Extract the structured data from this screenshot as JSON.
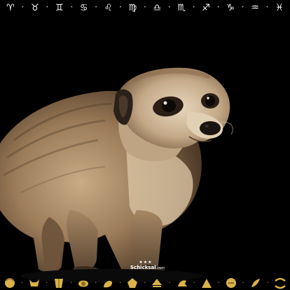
{
  "zodiac": {
    "signs": [
      {
        "name": "aries",
        "glyph": "♈"
      },
      {
        "name": "taurus",
        "glyph": "♉"
      },
      {
        "name": "gemini",
        "glyph": "♊"
      },
      {
        "name": "cancer",
        "glyph": "♋"
      },
      {
        "name": "leo",
        "glyph": "♌"
      },
      {
        "name": "virgo",
        "glyph": "♍"
      },
      {
        "name": "libra",
        "glyph": "♎"
      },
      {
        "name": "scorpio",
        "glyph": "♏"
      },
      {
        "name": "sagittarius",
        "glyph": "♐"
      },
      {
        "name": "capricorn",
        "glyph": "♑"
      },
      {
        "name": "aquarius",
        "glyph": "♒"
      },
      {
        "name": "pisces",
        "glyph": "♓"
      }
    ],
    "separator": "•"
  },
  "logo": {
    "stars": "★★★",
    "name": "Schicksal",
    "suffix": ".com"
  },
  "gold_bar": {
    "separator": "•",
    "icons": [
      "ram-icon",
      "bull-icon",
      "twins-icon",
      "crab-icon",
      "lion-icon",
      "maiden-icon",
      "scales-icon",
      "scorpion-icon",
      "archer-icon",
      "goat-icon",
      "waterbearer-icon",
      "fish-icon"
    ]
  },
  "colors": {
    "background": "#000000",
    "gold": "#d9b24a",
    "gold_dark": "#8c6a1e"
  }
}
